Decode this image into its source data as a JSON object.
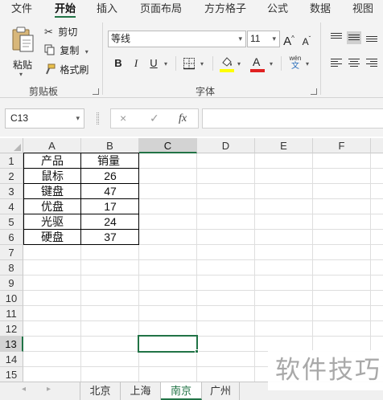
{
  "menu": {
    "tabs": [
      "文件",
      "开始",
      "插入",
      "页面布局",
      "方方格子",
      "公式",
      "数据",
      "视图"
    ],
    "active_index": 1
  },
  "ribbon": {
    "clipboard": {
      "paste_label": "粘贴",
      "cut_label": "剪切",
      "copy_label": "复制",
      "format_painter_label": "格式刷",
      "group_label": "剪贴板"
    },
    "font": {
      "font_name": "等线",
      "font_size": "11",
      "grow_font_label": "A",
      "shrink_font_label": "A",
      "bold_label": "B",
      "italic_label": "I",
      "underline_label": "U",
      "font_color_label": "A",
      "phonetic_label": "wén",
      "phonetic_sub_label": "文",
      "group_label": "字体",
      "highlight_color": "#ffff00",
      "font_color": "#e02020"
    }
  },
  "formula_bar": {
    "name_box": "C13",
    "cancel_icon": "×",
    "enter_icon": "✓",
    "fx_label": "fx",
    "formula": ""
  },
  "grid": {
    "columns": [
      "A",
      "B",
      "C",
      "D",
      "E",
      "F"
    ],
    "active_column": "C",
    "rows": [
      "1",
      "2",
      "3",
      "4",
      "5",
      "6",
      "7",
      "8",
      "9",
      "10",
      "11",
      "12",
      "13",
      "14",
      "15"
    ],
    "active_row": "13",
    "table": {
      "headers": [
        "产品",
        "销量"
      ],
      "rows": [
        [
          "鼠标",
          "26"
        ],
        [
          "键盘",
          "47"
        ],
        [
          "优盘",
          "17"
        ],
        [
          "光驱",
          "24"
        ],
        [
          "硬盘",
          "37"
        ]
      ]
    }
  },
  "sheets": {
    "tabs": [
      "北京",
      "上海",
      "南京",
      "广州"
    ],
    "active_index": 2
  },
  "watermark": "软件技巧",
  "colors": {
    "accent": "#217346"
  }
}
